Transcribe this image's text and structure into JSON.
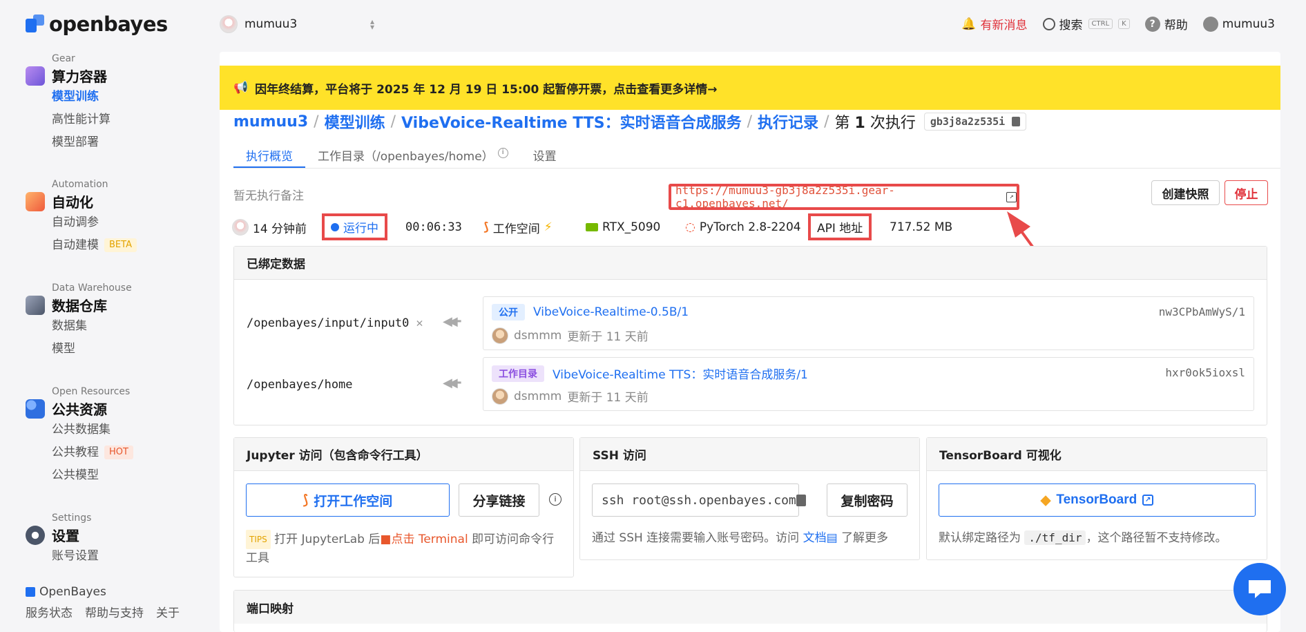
{
  "brand": {
    "name": "openbayes",
    "footer_name": "OpenBayes"
  },
  "sidebar": {
    "sections": [
      {
        "en": "Gear",
        "title": "算力容器",
        "items": [
          {
            "label": "模型训练",
            "active": true
          },
          {
            "label": "高性能计算"
          },
          {
            "label": "模型部署"
          }
        ]
      },
      {
        "en": "Automation",
        "title": "自动化",
        "items": [
          {
            "label": "自动调参"
          },
          {
            "label": "自动建模",
            "badge": "BETA"
          }
        ]
      },
      {
        "en": "Data Warehouse",
        "title": "数据仓库",
        "items": [
          {
            "label": "数据集"
          },
          {
            "label": "模型"
          }
        ]
      },
      {
        "en": "Open Resources",
        "title": "公共资源",
        "items": [
          {
            "label": "公共数据集"
          },
          {
            "label": "公共教程",
            "badge": "HOT"
          },
          {
            "label": "公共模型"
          }
        ]
      },
      {
        "en": "Settings",
        "title": "设置",
        "items": [
          {
            "label": "账号设置"
          }
        ]
      }
    ],
    "footer_links": [
      "服务状态",
      "帮助与支持",
      "关于"
    ]
  },
  "topbar": {
    "workspace_user": "mumuu3",
    "notifications": "有新消息",
    "search": "搜索",
    "kbd_ctrl": "CTRL",
    "kbd_k": "K",
    "help": "帮助",
    "account": "mumuu3"
  },
  "banner": {
    "icon": "📢",
    "text": "因年终结算，平台将于 2025 年 12 月 19 日 15:00 起暂停开票，点击查看更多详情→"
  },
  "breadcrumb": {
    "user": "mumuu3",
    "section": "模型训练",
    "project": "VibeVoice-Realtime TTS：实时语音合成服务",
    "records": "执行记录",
    "run_prefix": "第",
    "run_num": "1",
    "run_suffix": "次执行",
    "run_id": "gb3j8a2z535i"
  },
  "tabs": [
    "执行概览",
    "工作目录（/openbayes/home）",
    "设置"
  ],
  "note_placeholder": "暂无执行备注",
  "api_url": "https://mumuu3-gb3j8a2z535i.gear-c1.openbayes.net/",
  "buttons": {
    "snapshot": "创建快照",
    "stop": "停止"
  },
  "status": {
    "time_ago": "14 分钟前",
    "state": "运行中",
    "duration": "00:06:33",
    "workspace": "工作空间",
    "gpu": "RTX_5090",
    "framework": "PyTorch 2.8-2204",
    "api": "API 地址",
    "size": "717.52 MB"
  },
  "bound_data": {
    "title": "已绑定数据",
    "items": [
      {
        "path": "/openbayes/input/input0",
        "tag": "公开",
        "name": "VibeVoice-Realtime-0.5B/1",
        "hash": "nw3CPbAmWyS/1",
        "user": "dsmmm",
        "updated": "更新于 11 天前"
      },
      {
        "path": "/openbayes/home",
        "tag": "工作目录",
        "name": "VibeVoice-Realtime TTS：实时语音合成服务/1",
        "hash": "hxr0ok5ioxsl",
        "user": "dsmmm",
        "updated": "更新于 11 天前"
      }
    ]
  },
  "jupyter": {
    "title": "Jupyter 访问（包含命令行工具）",
    "open": "打开工作空间",
    "share": "分享链接",
    "tips": "TIPS",
    "help_a": "打开 JupyterLab 后",
    "help_click": "点击 Terminal",
    "help_b": "即可访问命令行工具"
  },
  "ssh": {
    "title": "SSH 访问",
    "command": "ssh root@ssh.openbayes.com",
    "copy_pw": "复制密码",
    "help_a": "通过 SSH 连接需要输入账号密码。访问",
    "help_link": "文档",
    "help_b": "了解更多"
  },
  "tensorboard": {
    "title": "TensorBoard 可视化",
    "button": "TensorBoard",
    "help_a": "默认绑定路径为",
    "help_code": "./tf_dir",
    "help_b": "，这个路径暂不支持修改。"
  },
  "ports": {
    "title": "端口映射"
  },
  "colors": {
    "accent": "#1f6ff0",
    "danger": "#e0313a",
    "banner": "#ffe229",
    "annotation": "#e84a4a"
  }
}
